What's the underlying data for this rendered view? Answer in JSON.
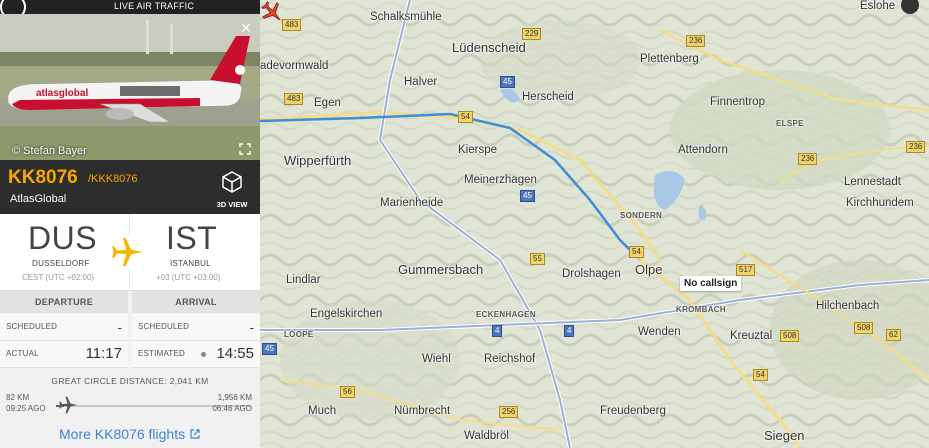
{
  "header": {
    "live_label": "LIVE AIR TRAFFIC"
  },
  "photo": {
    "credit": "© Stefan Bayer",
    "close_glyph": "×"
  },
  "flight": {
    "number": "KK8076",
    "callsign": "/KKK8076",
    "airline": "AtlasGlobal",
    "view3d_label": "3D VIEW"
  },
  "origin": {
    "iata": "DUS",
    "city": "DUSSELDORF",
    "tz": "CEST (UTC +02:00)"
  },
  "destination": {
    "iata": "IST",
    "city": "ISTANBUL",
    "tz": "+03 (UTC +03:00)"
  },
  "times": {
    "departure_header": "DEPARTURE",
    "arrival_header": "ARRIVAL",
    "scheduled_label": "SCHEDULED",
    "dep_scheduled": "-",
    "arr_scheduled": "-",
    "actual_label": "ACTUAL",
    "dep_actual": "11:17",
    "estimated_label": "ESTIMATED",
    "arr_estimated": "14:55"
  },
  "distance": {
    "label": "GREAT CIRCLE DISTANCE: 2,041 KM",
    "flown_km": "82 KM",
    "flown_ago": "09:25 AGO",
    "remaining_km": "1,956 KM",
    "remaining_ago": "06:46 AGO",
    "progress_fraction": 0.04
  },
  "more_link": "More KK8076 flights",
  "map": {
    "marker_label": "No callsign",
    "towns_big": [
      "Lüdenscheid",
      "Wipperfürth",
      "Gummersbach",
      "Olpe",
      "Siegen"
    ],
    "towns_mid": [
      "Schalksmühle",
      "Halver",
      "Egen",
      "Herscheid",
      "Plettenberg",
      "Finnentrop",
      "Attendorn",
      "Lennestadt",
      "Kirchhundem",
      "Kierspe",
      "Meinerzhagen",
      "Marienheide",
      "Drolshagen",
      "Lindlar",
      "Engelskirchen",
      "Wiehl",
      "Reichshof",
      "Wenden",
      "Kreuztal",
      "Hilchenbach",
      "Much",
      "Nümbrecht",
      "Freudenberg",
      "Waldbröl",
      "adevormwald",
      "Eslohe"
    ],
    "towns_small": [
      "ELSPE",
      "SONDERN",
      "ECKENHAGEN",
      "KROMBACH",
      "LOOPE"
    ],
    "shields_yellow": [
      "483",
      "229",
      "236",
      "483",
      "54",
      "236",
      "55",
      "54",
      "517",
      "508",
      "508",
      "62",
      "54",
      "256",
      "56",
      "236"
    ],
    "shields_blue": [
      "45",
      "45",
      "4",
      "4",
      "45"
    ]
  },
  "colors": {
    "accent": "#f7a600",
    "track": "#3c8fd6",
    "link": "#3b84d6"
  }
}
